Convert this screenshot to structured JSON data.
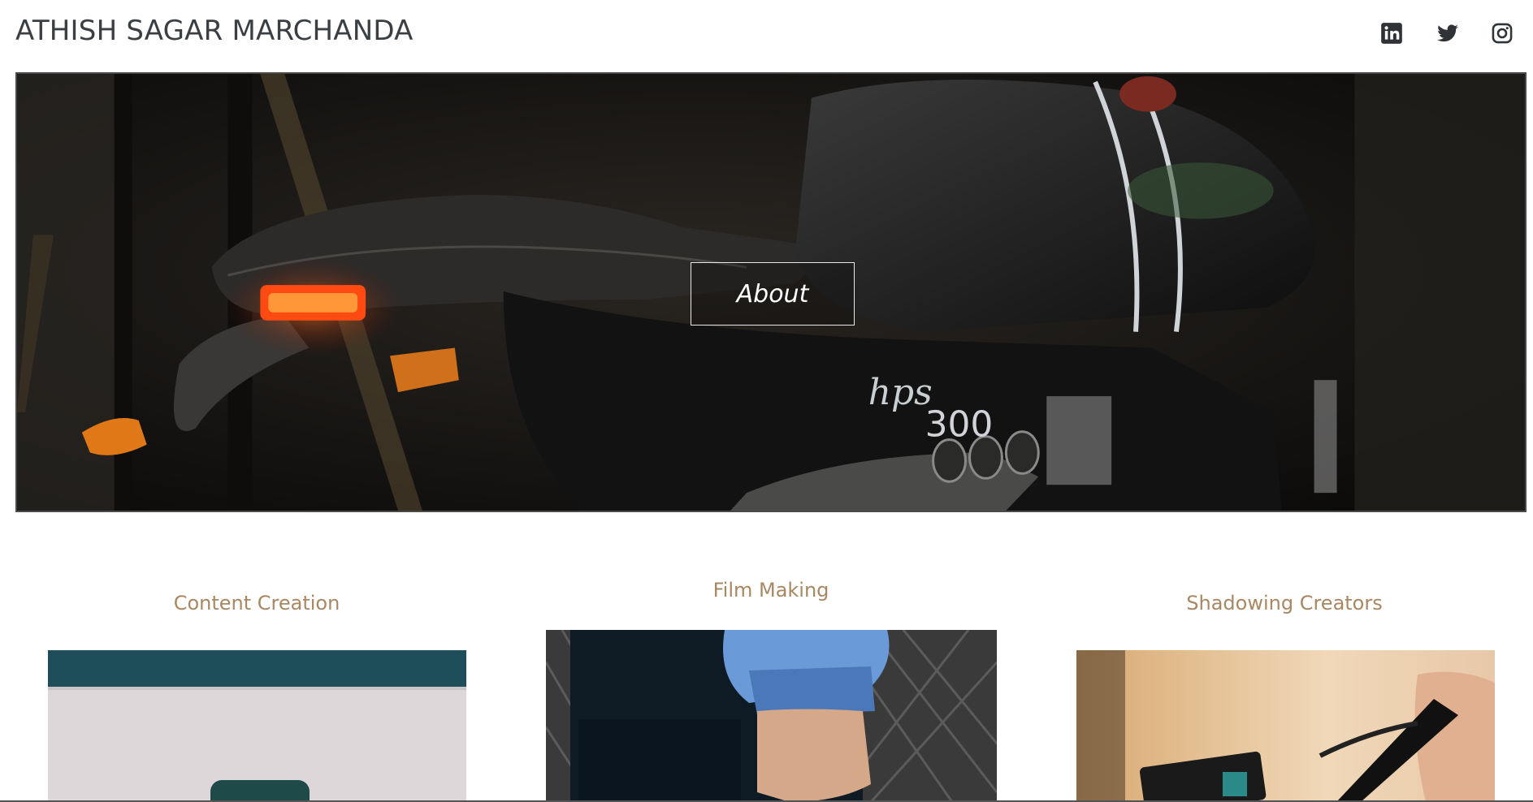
{
  "header": {
    "site_title": "ATHISH SAGAR MARCHANDA",
    "social_icons": [
      "linkedin-icon",
      "twitter-icon",
      "instagram-icon"
    ],
    "icon_color": "#2f3338"
  },
  "hero": {
    "about_button": "About",
    "image_subject": "black motorcycle rear with red tail light"
  },
  "services": [
    {
      "title": "Content Creation",
      "image_subject": "laptop back with teal background"
    },
    {
      "title": "Film Making",
      "image_subject": "person in blue jacket near chain fence"
    },
    {
      "title": "Shadowing Creators",
      "image_subject": "hands holding camera gimbal"
    }
  ],
  "colors": {
    "title_text": "#3a3f44",
    "service_title": "#a88763",
    "hero_border": "#4a4a4a"
  }
}
